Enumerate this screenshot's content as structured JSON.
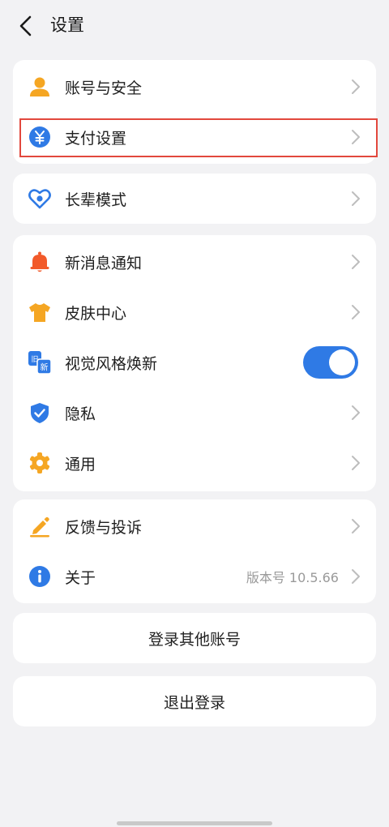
{
  "header": {
    "title": "设置"
  },
  "section1": {
    "items": [
      {
        "label": "账号与安全",
        "icon": "user-icon"
      },
      {
        "label": "支付设置",
        "icon": "yuan-icon"
      }
    ]
  },
  "section2": {
    "items": [
      {
        "label": "长辈模式",
        "icon": "heart-icon"
      }
    ]
  },
  "section3": {
    "items": [
      {
        "label": "新消息通知",
        "icon": "bell-icon"
      },
      {
        "label": "皮肤中心",
        "icon": "shirt-icon"
      },
      {
        "label": "视觉风格焕新",
        "icon": "style-icon",
        "toggle": true,
        "badge_old": "旧",
        "badge_new": "新"
      },
      {
        "label": "隐私",
        "icon": "shield-icon"
      },
      {
        "label": "通用",
        "icon": "gear-icon"
      }
    ]
  },
  "section4": {
    "items": [
      {
        "label": "反馈与投诉",
        "icon": "pen-icon"
      },
      {
        "label": "关于",
        "icon": "info-icon",
        "value": "版本号 10.5.66"
      }
    ]
  },
  "buttons": {
    "switch_account": "登录其他账号",
    "logout": "退出登录"
  },
  "colors": {
    "accent": "#2f7ae5",
    "highlight_border": "#e2483d",
    "orange": "#f5a623",
    "red_orange": "#f25a2a",
    "background": "#f2f2f4"
  }
}
